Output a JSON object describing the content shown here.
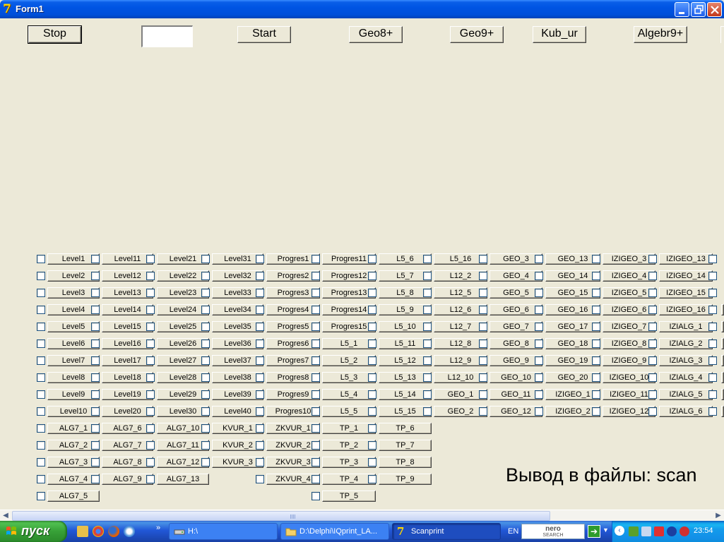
{
  "window": {
    "title": "Form1"
  },
  "toolbar": {
    "stop_label": "Stop",
    "input_value": "",
    "start_label": "Start",
    "geo8_label": "Geo8+",
    "geo9_label": "Geo9+",
    "kubur_label": "Kub_ur",
    "algebr9_label": "Algebr9+"
  },
  "grid": {
    "columns": [
      [
        "Level1",
        "Level2",
        "Level3",
        "Level4",
        "Level5",
        "Level6",
        "Level7",
        "Level8",
        "Level9",
        "Level10",
        "ALG7_1",
        "ALG7_2",
        "ALG7_3",
        "ALG7_4",
        "ALG7_5"
      ],
      [
        "Level11",
        "Level12",
        "Level13",
        "Level14",
        "Level15",
        "Level16",
        "Level17",
        "Level18",
        "Level19",
        "Level20",
        "ALG7_6",
        "ALG7_7",
        "ALG7_8",
        "ALG7_9"
      ],
      [
        "Level21",
        "Level22",
        "Level23",
        "Level24",
        "Level25",
        "Level26",
        "Level27",
        "Level28",
        "Level29",
        "Level30",
        "ALG7_10",
        "ALG7_11",
        "ALG7_12",
        "ALG7_13"
      ],
      [
        "Level31",
        "Level32",
        "Level33",
        "Level34",
        "Level35",
        "Level36",
        "Level37",
        "Level38",
        "Level39",
        "Level40",
        "KVUR_1",
        "KVUR_2",
        "KVUR_3"
      ],
      [
        "Progres1",
        "Progres2",
        "Progres3",
        "Progres4",
        "Progres5",
        "Progres6",
        "Progres7",
        "Progres8",
        "Progres9",
        "Progres10",
        "ZKVUR_1",
        "ZKVUR_2",
        "ZKVUR_3",
        "ZKVUR_4"
      ],
      [
        "Progres11",
        "Progres12",
        "Progres13",
        "Progres14",
        "Progres15",
        "L5_1",
        "L5_2",
        "L5_3",
        "L5_4",
        "L5_5",
        "TP_1",
        "TP_2",
        "TP_3",
        "TP_4",
        "TP_5"
      ],
      [
        "L5_6",
        "L5_7",
        "L5_8",
        "L5_9",
        "L5_10",
        "L5_11",
        "L5_12",
        "L5_13",
        "L5_14",
        "L5_15",
        "TP_6",
        "TP_7",
        "TP_8",
        "TP_9"
      ],
      [
        "L5_16",
        "L12_2",
        "L12_5",
        "L12_6",
        "L12_7",
        "L12_8",
        "L12_9",
        "L12_10",
        "GEO_1",
        "GEO_2"
      ],
      [
        "GEO_3",
        "GEO_4",
        "GEO_5",
        "GEO_6",
        "GEO_7",
        "GEO_8",
        "GEO_9",
        "GEO_10",
        "GEO_11",
        "GEO_12"
      ],
      [
        "GEO_13",
        "GEO_14",
        "GEO_15",
        "GEO_16",
        "GEO_17",
        "GEO_18",
        "GEO_19",
        "GEO_20",
        "IZIGEO_1",
        "IZIGEO_2"
      ],
      [
        "IZIGEO_3",
        "IZIGEO_4",
        "IZIGEO_5",
        "IZIGEO_6",
        "IZIGEO_7",
        "IZIGEO_8",
        "IZIGEO_9",
        "IZIGEO_10",
        "IZIGEO_11",
        "IZIGEO_12"
      ],
      [
        "IZIGEO_13",
        "IZIGEO_14",
        "IZIGEO_15",
        "IZIGEO_16",
        "IZIALG_1",
        "IZIALG_2",
        "IZIALG_3",
        "IZIALG_4",
        "IZIALG_5",
        "IZIALG_6"
      ]
    ]
  },
  "output_label": "Вывод в файлы: scan",
  "taskbar": {
    "start_label": "пуск",
    "tasks": [
      {
        "label": "H:\\",
        "active": false
      },
      {
        "label": "D:\\Delphi\\IQprint_LA...",
        "active": false
      },
      {
        "label": "Scanprint",
        "active": true
      }
    ],
    "language": "EN",
    "nero_line1": "nero",
    "nero_line2": "SEARCH",
    "clock": "23:54"
  },
  "colors": {
    "form_bg": "#ECE9D8",
    "titlebar": "#0054E3",
    "taskbar": "#245EDC",
    "start": "#3C9B3C",
    "tray": "#1290E8"
  }
}
